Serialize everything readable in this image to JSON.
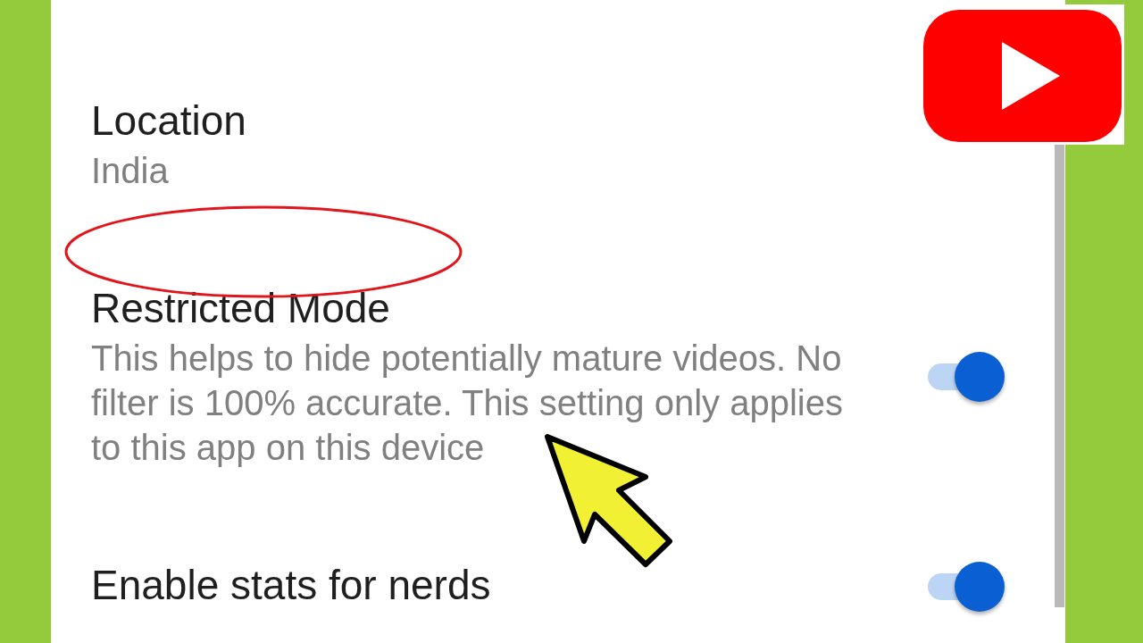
{
  "settings": [
    {
      "kind": "info",
      "title": "Location",
      "value": "India"
    },
    {
      "kind": "toggle",
      "title": "Restricted Mode",
      "description": "This helps to hide potentially mature videos. No filter is 100% accurate. This setting only applies to this app on this device",
      "on": true
    },
    {
      "kind": "toggle",
      "title": "Enable stats for nerds",
      "on": true
    }
  ]
}
